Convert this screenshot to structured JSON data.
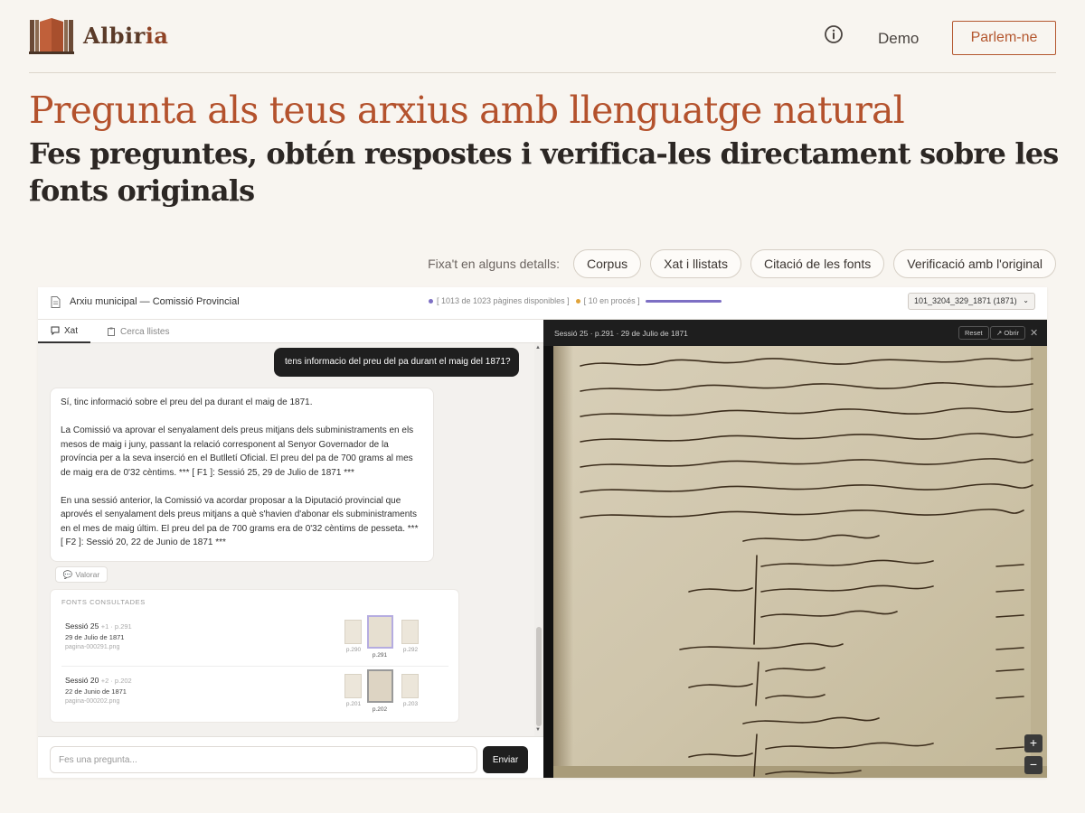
{
  "nav": {
    "brand_dark": "Albir",
    "brand_accent": "ia",
    "demo": "Demo",
    "cta": "Parlem-ne"
  },
  "hero": {
    "title": "Pregunta als teus arxius amb llenguatge natural",
    "subtitle": "Fes preguntes, obtén respostes i verifica-les directament sobre les fonts originals"
  },
  "features": {
    "label": "Fixa't en alguns detalls:",
    "chips": [
      "Corpus",
      "Xat i llistats",
      "Citació de les fonts",
      "Verificació amb l'original"
    ]
  },
  "app": {
    "title": "Arxiu municipal — Comissió Provincial",
    "pages_available": "[ 1013 de 1023 pàgines disponibles ]",
    "in_process": "[ 10 en procés ]",
    "selected_doc": "101_3204_329_1871 (1871)",
    "tabs": [
      "Xat",
      "Cerca llistes"
    ],
    "user_message": "tens informacio del preu del pa durant el maig del 1871?",
    "bot_paragraphs": [
      "Sí, tinc informació sobre el preu del pa durant el maig de 1871.",
      "La Comissió va aprovar el senyalament dels preus mitjans dels subministraments en els mesos de maig i juny, passant la relació corresponent al Senyor Governador de la província per a la seva inserció en el Butlletí Oficial. El preu del pa de 700 grams al mes de maig era de 0'32 cèntims. *** [ F1 ]: Sessió 25, 29 de Julio de 1871 ***",
      "En una sessió anterior, la Comissió va acordar proposar a la Diputació provincial que aprovés el senyalament dels preus mitjans a què s'havien d'abonar els subministraments en el mes de maig últim. El preu del pa de 700 grams era de 0'32 cèntims de pesseta. *** [ F2 ]: Sessió 20, 22 de Junio de 1871 ***"
    ],
    "rate_label": "Valorar",
    "sources_title": "FONTS CONSULTADES",
    "sources": [
      {
        "name": "Sessió 25",
        "meta": "+1 · p.291",
        "date": "29 de Julio de 1871",
        "file": "pagina-000291.png",
        "thumbs": [
          "p.290",
          "p.291",
          "p.292"
        ]
      },
      {
        "name": "Sessió 20",
        "meta": "+2 · p.202",
        "date": "22 de Junio de 1871",
        "file": "pagina-000202.png",
        "thumbs": [
          "p.201",
          "p.202",
          "p.203"
        ]
      }
    ],
    "input_placeholder": "Fes una pregunta...",
    "send_label": "Enviar",
    "viewer_title": "Sessió 25 · p.291 · 29 de Julio de 1871",
    "reset_label": "Reset",
    "open_label": "↗ Obrir",
    "colors": {
      "accent": "#b4522d",
      "progress": "#7d6fc4",
      "dot_available": "#7d6fc4",
      "dot_process": "#e0a33a"
    }
  }
}
